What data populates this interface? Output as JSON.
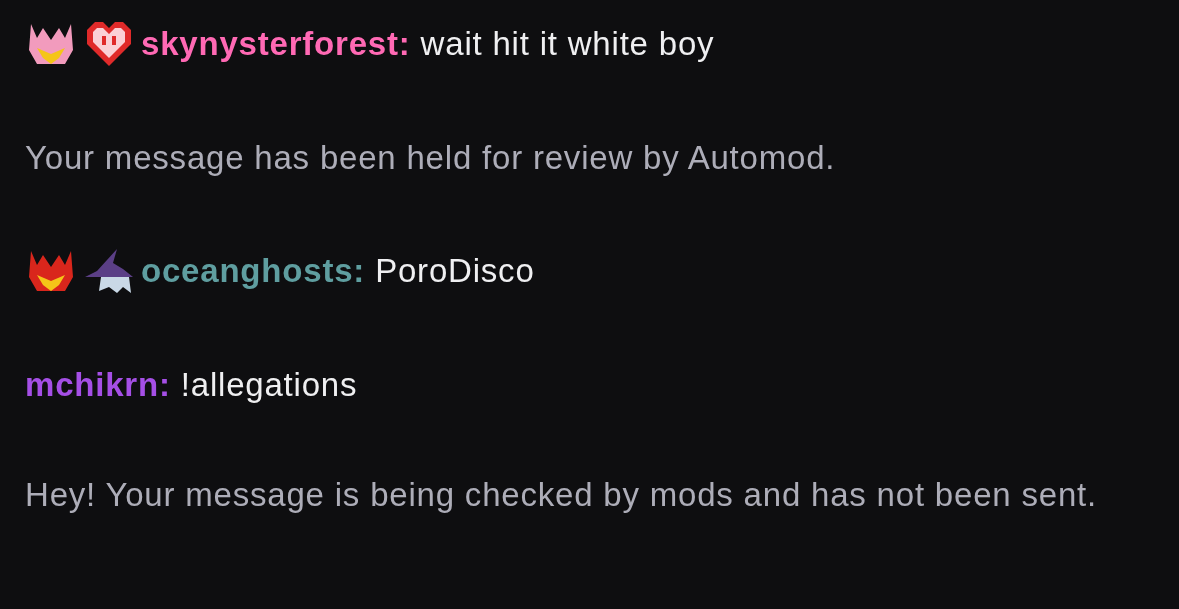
{
  "messages": [
    {
      "kind": "chat",
      "badges": [
        {
          "kind": "helmet",
          "color": "#f29bbd"
        },
        {
          "kind": "heart"
        }
      ],
      "user": "skynysterforest:",
      "color": "#ff69b4",
      "text": "wait hit it white boy"
    },
    {
      "kind": "notice",
      "text": "Your message has been held for review by Automod."
    },
    {
      "kind": "chat",
      "badges": [
        {
          "kind": "helmet",
          "color": "#d9261c"
        },
        {
          "kind": "wizard"
        }
      ],
      "user": "oceanghosts:",
      "color": "#5f9ea0",
      "text": "PoroDisco"
    },
    {
      "kind": "chat",
      "user": "mchikrn:",
      "color": "#a54fe6",
      "text": "!allegations"
    },
    {
      "kind": "notice",
      "text": "Hey! Your message is being checked by mods and has not been sent."
    }
  ]
}
